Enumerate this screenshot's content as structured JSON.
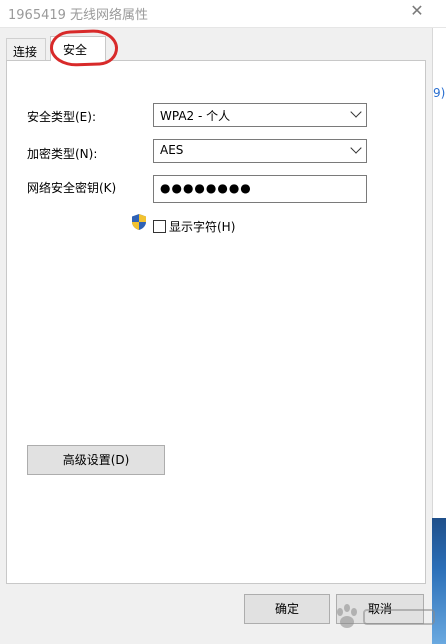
{
  "window": {
    "title": "1965419 无线网络属性",
    "close_glyph": "✕"
  },
  "background": {
    "link_fragment": "9)"
  },
  "tabs": [
    {
      "label": "连接"
    },
    {
      "label": "安全",
      "active": true
    }
  ],
  "form": {
    "security_type_label": "安全类型(E):",
    "security_type_value": "WPA2 - 个人",
    "encryption_type_label": "加密类型(N):",
    "encryption_type_value": "AES",
    "network_key_label": "网络安全密钥(K)",
    "network_key_value": "●●●●●●●●",
    "show_chars_label": "显示字符(H)",
    "show_chars_checked": false
  },
  "buttons": {
    "advanced": "高级设置(D)",
    "ok": "确定",
    "cancel": "取消"
  },
  "annotation": {
    "color": "#d82a2a"
  },
  "watermark": {
    "icon": "baidu-paw-logo"
  },
  "colors": {
    "link": "#2a6fd0",
    "button_face": "#e1e1e1"
  }
}
